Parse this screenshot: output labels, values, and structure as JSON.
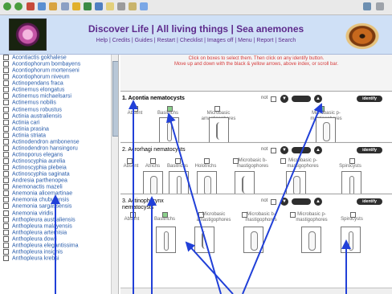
{
  "header": {
    "title": "Discover Life | All living things | Sea anemones",
    "links": "Help | Credits | Guides | Restart | Checklist | Images off | Menu | Report | Search"
  },
  "sidebar": {
    "items": [
      "Acontiactis gokhalese",
      "Acontiophorum bombayens",
      "Acontiophorum mortenseni",
      "Acontiophorum niveum",
      "Actinopendans fraca",
      "Actinernus elongatus",
      "Actinernus michaelsarsi",
      "Actinernus nobilis",
      "Actinernus robustus",
      "Actinia australiensis",
      "Actinia cari",
      "Actinia prasina",
      "Actinia striata",
      "Actinodendron ambonense",
      "Actinodendron hansingoru",
      "Actinoporus elegans",
      "Actinoscyphia aurelia",
      "Actinoscyphia plebeia",
      "Actinoscyphia saginata",
      "Andresia parthenopea",
      "Anemonactis mazeli",
      "Anemonia alicemartinae",
      "Anemonia chubutensis",
      "Anemonia sargassensis",
      "Anemonia viridis",
      "Anthopleura australiensis",
      "Anthopleura malayensis",
      "Anthopleura artemisia",
      "Anthopleura dowii",
      "Anthopleura elegantissima",
      "Anthopleura insignis",
      "Anthopleura krebsi"
    ]
  },
  "main": {
    "instructions": [
      "Click on boxes to select them. Then click on any identify button.",
      "Move up and down with the black & yellow arrows, above index, or scroll bar."
    ],
    "not_label": "not",
    "sections": [
      {
        "title": "1. Acontia nematocysts",
        "identify_label": "identify",
        "options": [
          {
            "label": "Absent",
            "checked": false
          },
          {
            "label": "Basitrichs",
            "checked": true
          },
          {
            "label": "Microbasic amastigophores",
            "checked": false
          },
          {
            "label": "Microbasic p-mastigophores",
            "checked": true
          }
        ]
      },
      {
        "title": "2. Acrorhagi nematocysts",
        "identify_label": "identify",
        "options": [
          {
            "label": "Absent",
            "checked": false
          },
          {
            "label": "Atrichs",
            "checked": false
          },
          {
            "label": "Basitrichs",
            "checked": false
          },
          {
            "label": "Holotrichs",
            "checked": false
          },
          {
            "label": "Microbasic b-mastigophores",
            "checked": false
          },
          {
            "label": "Microbasic p-mastigophores",
            "checked": false
          },
          {
            "label": "Spirocysts",
            "checked": false
          }
        ]
      },
      {
        "title": "3. Actinopharynx nematocysts",
        "identify_label": "identify",
        "options": [
          {
            "label": "Absent",
            "checked": false
          },
          {
            "label": "Basitrichs",
            "checked": true
          },
          {
            "label": "Microbasic amastigophores",
            "checked": false
          },
          {
            "label": "Microbasic b-mastigophores",
            "checked": false
          },
          {
            "label": "Microbasic p-mastigophores",
            "checked": false
          },
          {
            "label": "Spirocysts",
            "checked": false
          }
        ]
      }
    ]
  },
  "colors": {
    "header_bg": "#cfe0f6",
    "link_purple": "#5e2b8c",
    "instruction_red": "#d63b3b",
    "annotation_blue": "#2140d8"
  }
}
